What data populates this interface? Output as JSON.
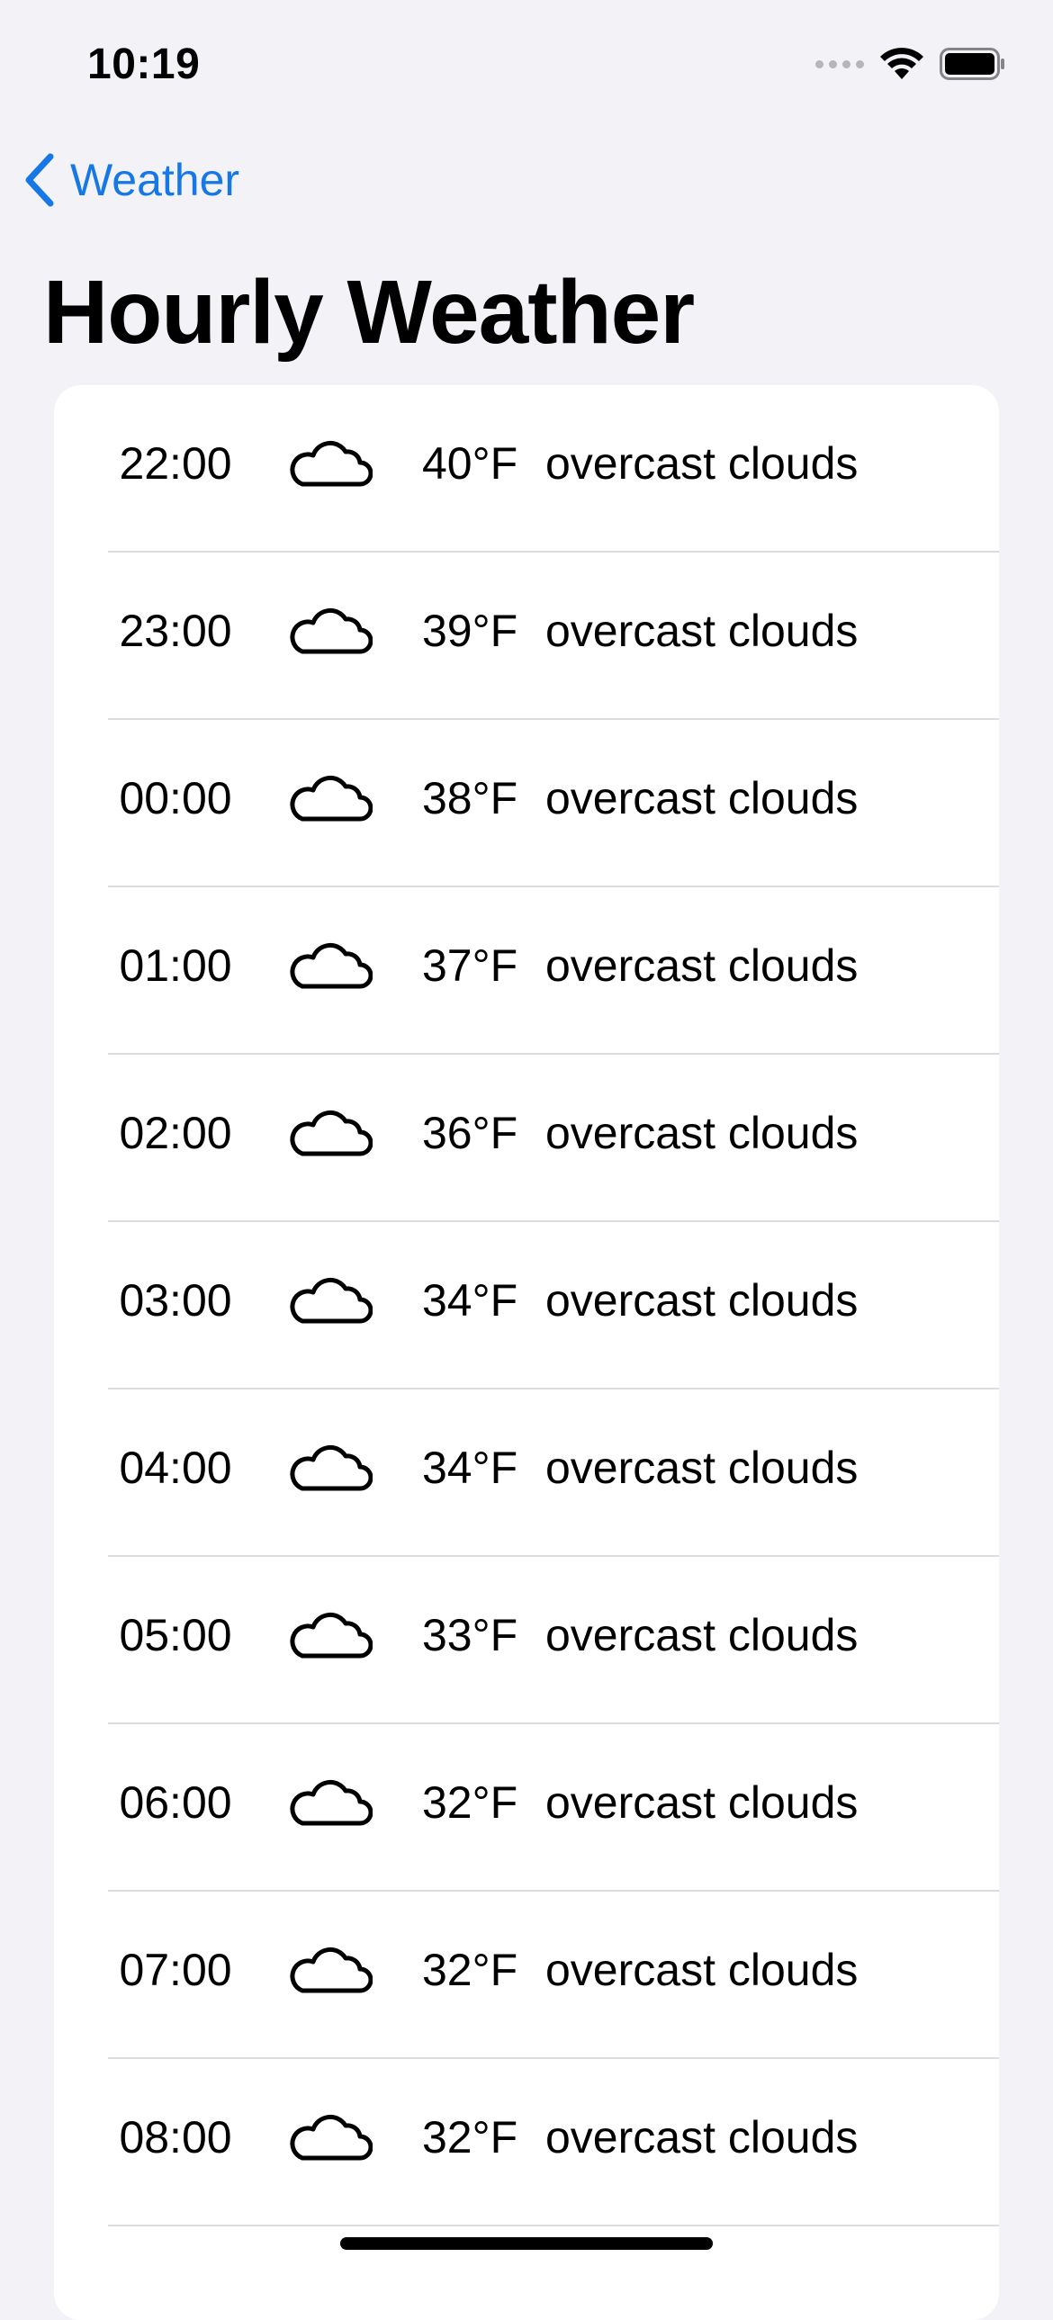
{
  "status_bar": {
    "time": "10:19"
  },
  "nav": {
    "back_label": "Weather"
  },
  "page": {
    "title": "Hourly Weather"
  },
  "hours": [
    {
      "time": "22:00",
      "icon": "cloud-icon",
      "temp": "40°F",
      "description": "overcast clouds"
    },
    {
      "time": "23:00",
      "icon": "cloud-icon",
      "temp": "39°F",
      "description": "overcast clouds"
    },
    {
      "time": "00:00",
      "icon": "cloud-icon",
      "temp": "38°F",
      "description": "overcast clouds"
    },
    {
      "time": "01:00",
      "icon": "cloud-icon",
      "temp": "37°F",
      "description": "overcast clouds"
    },
    {
      "time": "02:00",
      "icon": "cloud-icon",
      "temp": "36°F",
      "description": "overcast clouds"
    },
    {
      "time": "03:00",
      "icon": "cloud-icon",
      "temp": "34°F",
      "description": "overcast clouds"
    },
    {
      "time": "04:00",
      "icon": "cloud-icon",
      "temp": "34°F",
      "description": "overcast clouds"
    },
    {
      "time": "05:00",
      "icon": "cloud-icon",
      "temp": "33°F",
      "description": "overcast clouds"
    },
    {
      "time": "06:00",
      "icon": "cloud-icon",
      "temp": "32°F",
      "description": "overcast clouds"
    },
    {
      "time": "07:00",
      "icon": "cloud-icon",
      "temp": "32°F",
      "description": "overcast clouds"
    },
    {
      "time": "08:00",
      "icon": "cloud-icon",
      "temp": "32°F",
      "description": "overcast clouds"
    }
  ],
  "colors": {
    "accent": "#1677e6",
    "background": "#f2f2f7",
    "card": "#ffffff"
  }
}
